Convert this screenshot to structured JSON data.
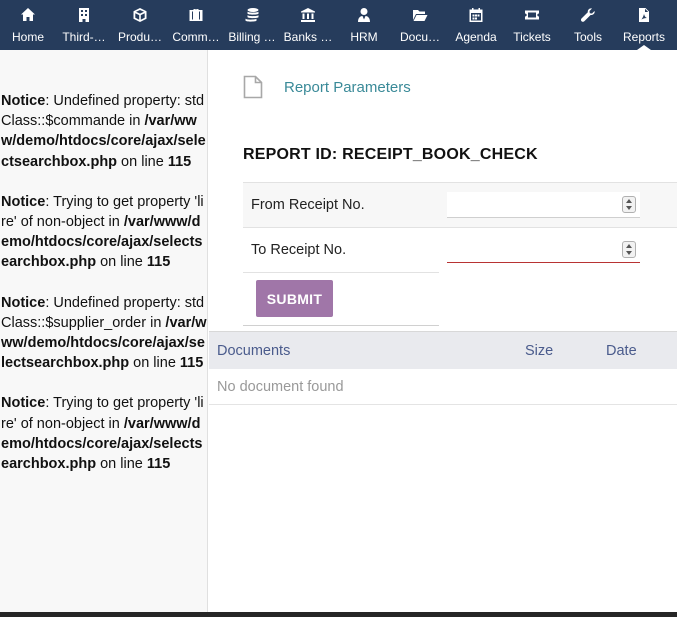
{
  "nav": {
    "items": [
      {
        "label": "Home",
        "icon": "home-icon"
      },
      {
        "label": "Third-…",
        "icon": "building-icon"
      },
      {
        "label": "Produ…",
        "icon": "cube-icon"
      },
      {
        "label": "Comm…",
        "icon": "briefcase-icon"
      },
      {
        "label": "Billing …",
        "icon": "coins-icon"
      },
      {
        "label": "Banks …",
        "icon": "bank-icon"
      },
      {
        "label": "HRM",
        "icon": "user-tie-icon"
      },
      {
        "label": "Docu…",
        "icon": "folder-open-icon"
      },
      {
        "label": "Agenda",
        "icon": "calendar-icon"
      },
      {
        "label": "Tickets",
        "icon": "ticket-icon"
      },
      {
        "label": "Tools",
        "icon": "wrench-icon"
      },
      {
        "label": "Reports",
        "icon": "pdf-file-icon"
      }
    ],
    "active": "Reports"
  },
  "notices": [
    {
      "kind": "Notice",
      "msg1": ": Undefined property: stdClass::$commande in ",
      "path": "/var/www/demo/htdocs/core/ajax/selectsearchbox.php",
      "msg2": " on line ",
      "line": "115"
    },
    {
      "kind": "Notice",
      "msg1": ": Trying to get property 'lire' of non-object in ",
      "path": "/var/www/demo/htdocs/core/ajax/selectsearchbox.php",
      "msg2": " on line ",
      "line": "115"
    },
    {
      "kind": "Notice",
      "msg1": ": Undefined property: stdClass::$supplier_order in ",
      "path": "/var/www/demo/htdocs/core/ajax/selectsearchbox.php",
      "msg2": " on line ",
      "line": "115"
    },
    {
      "kind": "Notice",
      "msg1": ": Trying to get property 'lire' of non-object in ",
      "path": "/var/www/demo/htdocs/core/ajax/selectsearchbox.php",
      "msg2": " on line ",
      "line": "115"
    }
  ],
  "params": {
    "title": "Report Parameters",
    "report_id": "REPORT ID: RECEIPT_BOOK_CHECK",
    "fields": [
      {
        "label": "From Receipt No.",
        "value": ""
      },
      {
        "label": "To Receipt No.",
        "value": ""
      }
    ],
    "submit_label": "SUBMIT"
  },
  "documents": {
    "columns": [
      "Documents",
      "Size",
      "Date"
    ],
    "empty_text": "No document found"
  },
  "colors": {
    "nav_bg": "#263c5c",
    "accent_link": "#3a8a98",
    "submit_bg": "#a076a8",
    "error_underline": "#b83333"
  }
}
